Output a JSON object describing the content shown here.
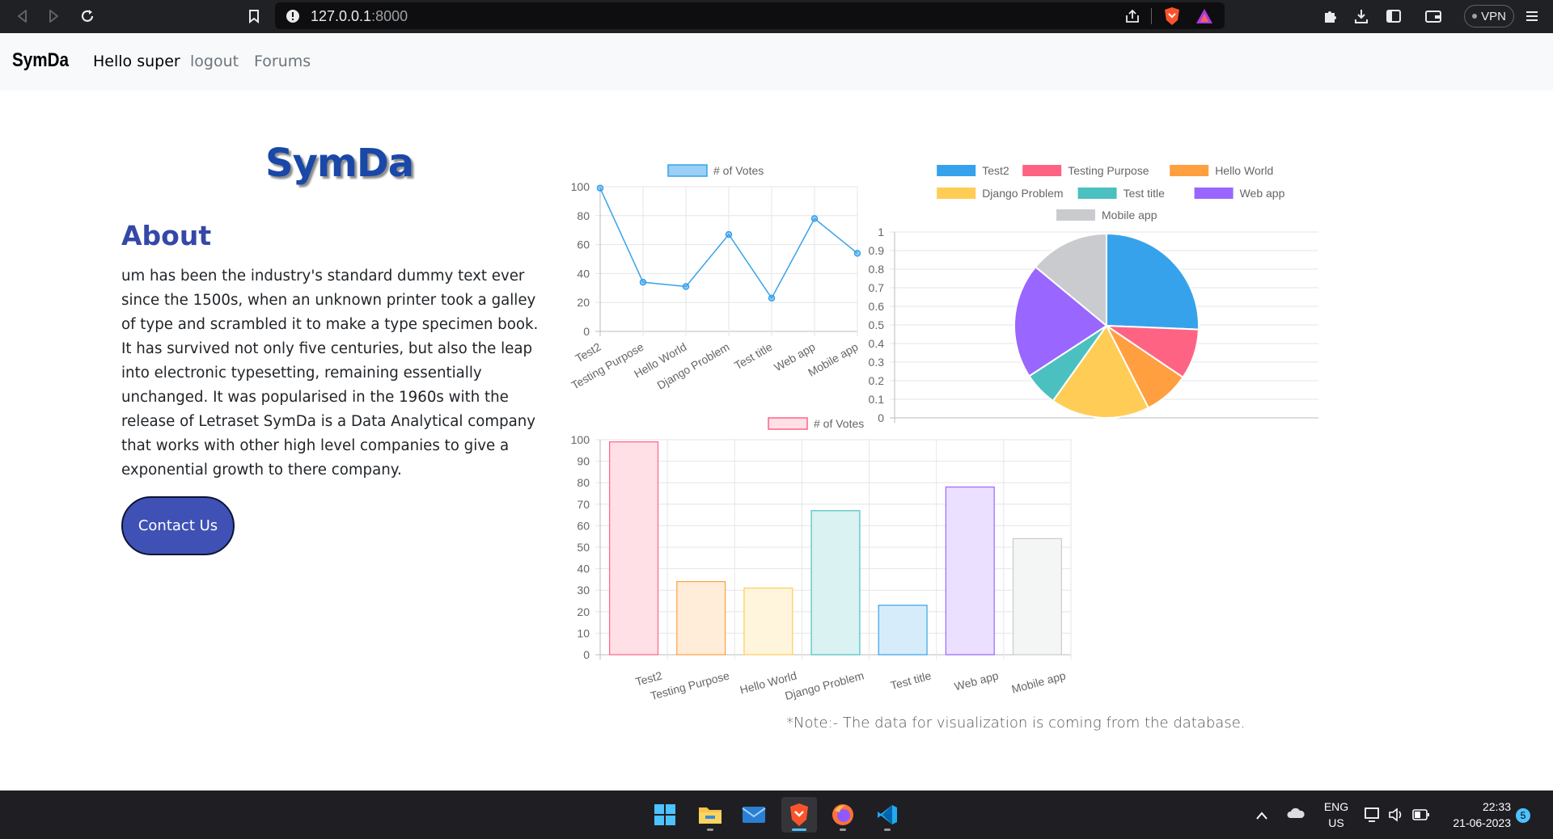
{
  "browser": {
    "url_host": "127.0.0.1",
    "url_port": ":8000",
    "vpn_label": "VPN"
  },
  "navbar": {
    "brand": "SymDa",
    "greeting": "Hello super",
    "logout": "logout",
    "forums": "Forums"
  },
  "main": {
    "hero_title": "SymDa",
    "about_title": "About",
    "about_text": "um has been the industry's standard dummy text ever since the 1500s, when an unknown printer took a galley of type and scrambled it to make a type specimen book. It has survived not only five centuries, but also the leap into electronic typesetting, remaining essentially unchanged. It was popularised in the 1960s with the release of Letraset SymDa is a Data Analytical company that works with other high level companies to give a exponential growth to there company.",
    "contact_button": "Contact Us",
    "note": "*Note:- The data for visualization is coming from the database."
  },
  "chart_data": [
    {
      "type": "line",
      "categories": [
        "Test2",
        "Testing Purpose",
        "Hello World",
        "Django Problem",
        "Test title",
        "Web app",
        "Mobile app"
      ],
      "series": [
        {
          "name": "# of Votes",
          "values": [
            99,
            34,
            31,
            67,
            23,
            78,
            54
          ]
        }
      ],
      "ylim": [
        0,
        100
      ],
      "yticks": [
        0,
        20,
        40,
        60,
        80,
        100
      ],
      "legend": "top",
      "grid": true,
      "color": "#36a2eb"
    },
    {
      "type": "pie",
      "categories": [
        "Test2",
        "Testing Purpose",
        "Hello World",
        "Django Problem",
        "Test title",
        "Web app",
        "Mobile app"
      ],
      "values": [
        99,
        34,
        31,
        67,
        23,
        78,
        54
      ],
      "colors": [
        "#36a2eb",
        "#ff6384",
        "#ff9f40",
        "#ffcd56",
        "#4bc0c0",
        "#9966ff",
        "#c9cbcf"
      ],
      "yticks": [
        0,
        0.1,
        0.2,
        0.3,
        0.4,
        0.5,
        0.6,
        0.7,
        0.8,
        0.9,
        1
      ],
      "legend": "top"
    },
    {
      "type": "bar",
      "categories": [
        "Test2",
        "Testing Purpose",
        "Hello World",
        "Django Problem",
        "Test title",
        "Web app",
        "Mobile app"
      ],
      "series": [
        {
          "name": "# of Votes",
          "values": [
            99,
            34,
            31,
            67,
            23,
            78,
            54
          ]
        }
      ],
      "ylim": [
        0,
        100
      ],
      "yticks": [
        0,
        10,
        20,
        30,
        40,
        50,
        60,
        70,
        80,
        90,
        100
      ],
      "legend": "top",
      "grid": true,
      "bar_fills": [
        "#ffe0e6",
        "#ffecd9",
        "#fff5dd",
        "#dbf2f2",
        "#d7ecfb",
        "#ebe0ff",
        "#f4f5f5"
      ],
      "bar_strokes": [
        "#ff6384",
        "#ff9f40",
        "#ffcd56",
        "#4bc0c0",
        "#36a2eb",
        "#9966ff",
        "#c9cbcf"
      ]
    }
  ],
  "taskbar": {
    "lang_top": "ENG",
    "lang_bottom": "US",
    "time": "22:33",
    "date": "21-06-2023",
    "notifications": "5"
  }
}
